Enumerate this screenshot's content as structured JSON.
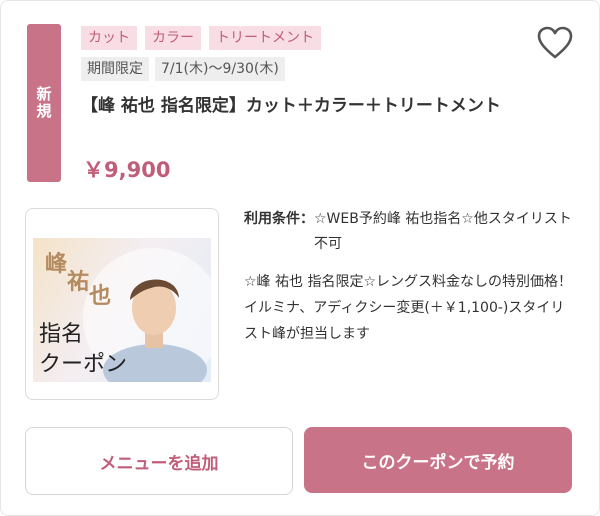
{
  "coupon": {
    "new_badge": "新規",
    "tags": [
      "カット",
      "カラー",
      "トリートメント"
    ],
    "period_label": "期間限定",
    "period_dates": "7/1(木)〜9/30(木)",
    "title": "【峰 祐也 指名限定】カット＋カラー＋トリートメント",
    "price": "￥9,900",
    "photo": {
      "name_chars": [
        "峰",
        "祐",
        "也"
      ],
      "line1": "指名",
      "line2": "クーポン"
    },
    "conditions_label": "利用条件：",
    "conditions_value": "☆WEB予約峰 祐也指名☆他スタイリスト不可",
    "description": "☆峰 祐也 指名限定☆レングス料金なしの特別価格！イルミナ、アディクシー変更(＋￥1,100-)スタイリスト峰が担当します"
  },
  "actions": {
    "add_menu": "メニューを追加",
    "reserve": "このクーポンで予約"
  },
  "icons": {
    "favorite": "heart-outline-icon"
  },
  "colors": {
    "accent": "#c97388",
    "tag_bg": "#f8dde4",
    "text_accent": "#c05d78"
  }
}
